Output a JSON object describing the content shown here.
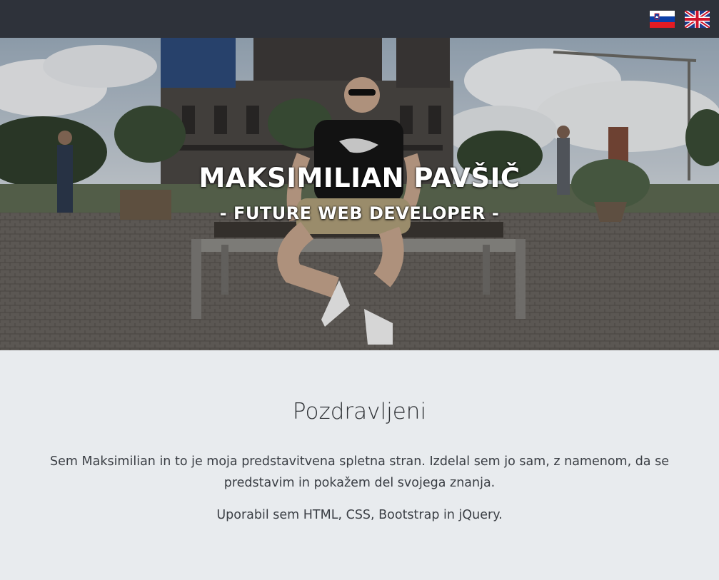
{
  "header": {
    "languages": [
      {
        "code": "sl",
        "icon": "slovenia-flag-icon"
      },
      {
        "code": "en",
        "icon": "uk-flag-icon"
      }
    ],
    "background_color": "#2e323a"
  },
  "hero": {
    "title": "MAKSIMILIAN PAVŠIČ",
    "subtitle": "- FUTURE WEB DEVELOPER -",
    "image": "photo-man-sitting-on-bench-berlin-cathedral"
  },
  "about": {
    "heading": "Pozdravljeni",
    "paragraph1": "Sem Maksimilian in to je moja predstavitvena spletna stran. Izdelal sem jo sam, z namenom, da se predstavim in pokažem del svojega znanja.",
    "paragraph2": "Uporabil sem HTML, CSS, Bootstrap in jQuery.",
    "background_color": "#e8ebee"
  }
}
